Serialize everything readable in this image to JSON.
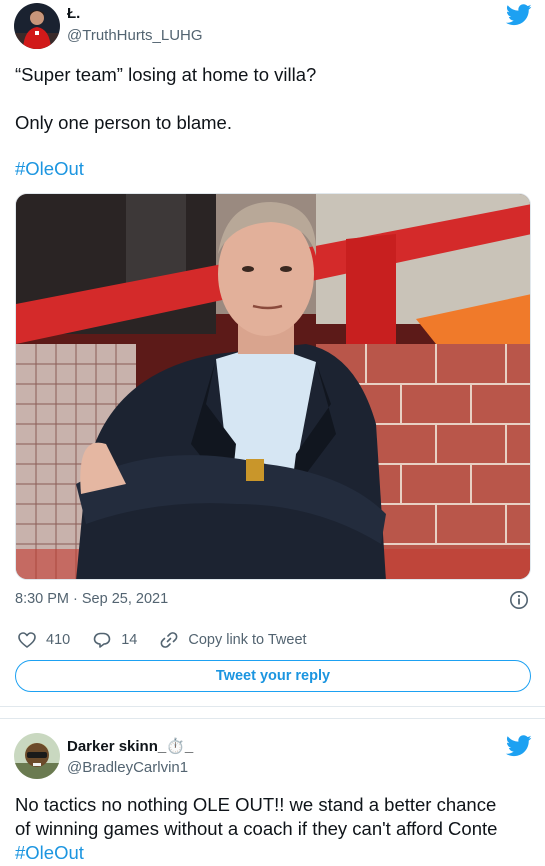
{
  "tweet": {
    "author_name": "Ł.",
    "author_handle": "@TruthHurts_LUHG",
    "text_line1": "“Super team” losing at home to villa?",
    "text_line2": "Only one person to blame.",
    "hashtag": "#OleOut",
    "timestamp": "8:30 PM · Sep 25, 2021",
    "like_count": "410",
    "reply_count": "14",
    "copy_link_label": "Copy link to Tweet",
    "reply_button_label": "Tweet your reply",
    "icons": [
      "twitter-bird-icon",
      "info-icon",
      "heart-icon",
      "reply-bubble-icon",
      "link-icon"
    ]
  },
  "reply_tweet": {
    "author_name": "Darker skinn_⏱️_",
    "author_handle": "@BradleyCarlvin1",
    "text_line1": "No tactics no nothing OLE OUT!! we stand a better chance",
    "text_line2": "of winning games without a coach if they can't afford Conte",
    "hashtag": "#OleOut"
  },
  "colors": {
    "accent": "#1da1f2",
    "hashtag": "#1b95e0",
    "text": "#0f1419",
    "secondary_text": "#536471",
    "border": "#e1e8ed"
  }
}
